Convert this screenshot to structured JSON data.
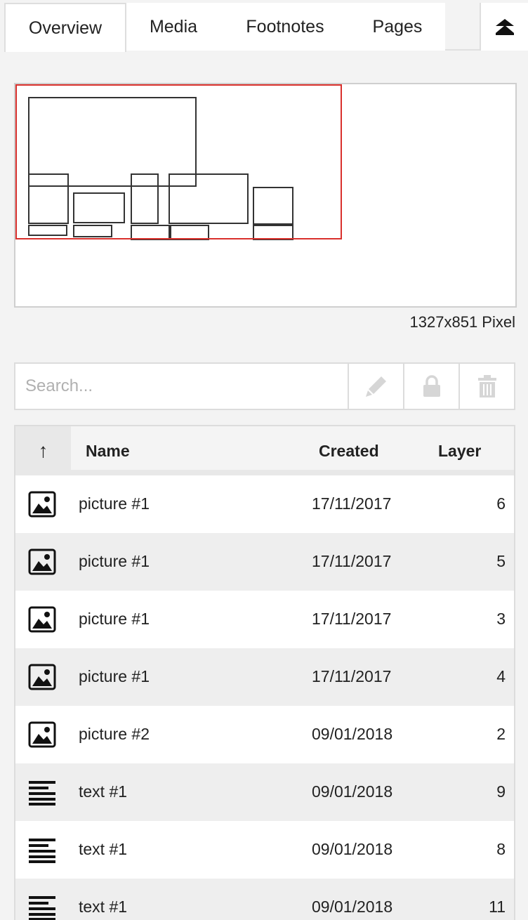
{
  "tabs": {
    "overview": "Overview",
    "media": "Media",
    "footnotes": "Footnotes",
    "pages": "Pages",
    "collapse_icon": "double-chevron-up-icon"
  },
  "preview": {
    "dimensions": "1327x851 Pixel",
    "viewport_color": "#d9302c"
  },
  "search": {
    "placeholder": "Search...",
    "edit_icon": "pencil-icon",
    "lock_icon": "lock-icon",
    "delete_icon": "trash-icon"
  },
  "table": {
    "sort_indicator": "↑",
    "columns": {
      "name": "Name",
      "created": "Created",
      "layer": "Layer"
    },
    "rows": [
      {
        "icon": "picture-icon",
        "name": "picture #1",
        "created": "17/11/2017",
        "layer": "6"
      },
      {
        "icon": "picture-icon",
        "name": "picture #1",
        "created": "17/11/2017",
        "layer": "5"
      },
      {
        "icon": "picture-icon",
        "name": "picture #1",
        "created": "17/11/2017",
        "layer": "3"
      },
      {
        "icon": "picture-icon",
        "name": "picture #1",
        "created": "17/11/2017",
        "layer": "4"
      },
      {
        "icon": "picture-icon",
        "name": "picture #2",
        "created": "09/01/2018",
        "layer": "2"
      },
      {
        "icon": "text-icon",
        "name": "text #1",
        "created": "09/01/2018",
        "layer": "9"
      },
      {
        "icon": "text-icon",
        "name": "text #1",
        "created": "09/01/2018",
        "layer": "8"
      },
      {
        "icon": "text-icon",
        "name": "text #1",
        "created": "09/01/2018",
        "layer": "11"
      }
    ]
  }
}
